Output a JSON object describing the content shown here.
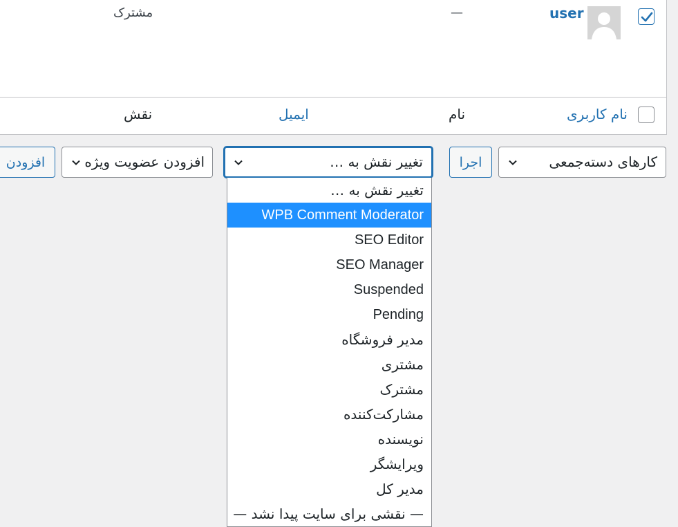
{
  "table": {
    "row": {
      "username": "user",
      "name": "—",
      "role": "مشترک",
      "checked": true
    },
    "columns": {
      "username": "نام کاربری",
      "name": "نام",
      "email": "ایمیل",
      "role": "نقش"
    }
  },
  "actions": {
    "bulk_label": "کارهای دسته‌جمعی",
    "apply_label": "اجرا",
    "role_select_label": "تغییر نقش به …",
    "membership_label": "افزودن عضویت ویژه",
    "add_label": "افزودن"
  },
  "role_options": [
    {
      "label": "تغییر نقش به …",
      "rtl": true
    },
    {
      "label": "WPB Comment Moderator",
      "rtl": false,
      "selected": true
    },
    {
      "label": "SEO Editor",
      "rtl": false
    },
    {
      "label": "SEO Manager",
      "rtl": false
    },
    {
      "label": "Suspended",
      "rtl": false
    },
    {
      "label": "Pending",
      "rtl": false
    },
    {
      "label": "مدیر فروشگاه",
      "rtl": true
    },
    {
      "label": "مشتری",
      "rtl": true
    },
    {
      "label": "مشترک",
      "rtl": true
    },
    {
      "label": "مشارکت‌کننده",
      "rtl": true
    },
    {
      "label": "نویسنده",
      "rtl": true
    },
    {
      "label": "ویرایشگر",
      "rtl": true
    },
    {
      "label": "مدیر کل",
      "rtl": true
    },
    {
      "label": "— نقشی برای سایت پیدا نشد —",
      "rtl": true
    }
  ],
  "colors": {
    "link": "#2271b1",
    "highlight": "#1e90ff",
    "background": "#f0f0f1"
  },
  "icons": {
    "checkbox": "check-icon",
    "avatar": "default-avatar-icon",
    "chevron": "chevron-down-icon"
  }
}
